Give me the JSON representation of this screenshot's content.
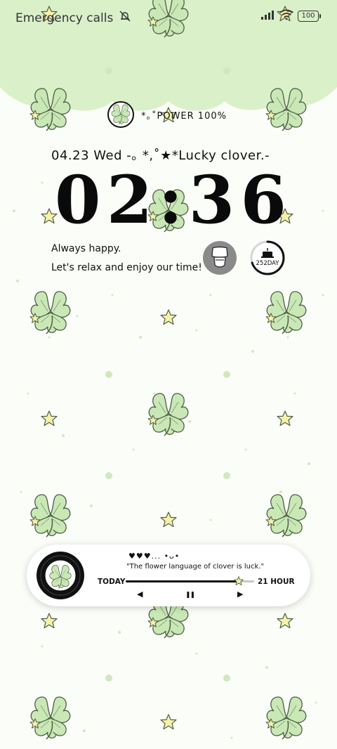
{
  "status_bar": {
    "carrier_text": "Emergency calls",
    "icons": [
      "mute-icon",
      "signal-icon",
      "wifi-icon",
      "battery-icon"
    ],
    "battery_level": "100"
  },
  "widget": {
    "power_text": "*｡˚POWER 100%",
    "date_line": "04.23 Wed -｡ *,˚★*Lucky clover.-",
    "time_digits": [
      "0",
      "2",
      ":",
      "3",
      "6"
    ],
    "message_1": "Always happy.",
    "message_2": "Let's relax and enjoy our time!",
    "day_counter": "252DAY",
    "day_ring_progress": 0.7
  },
  "music_player": {
    "hearts_text": "♥♥♥... •ᴗ•",
    "quote": "\"The flower language of clover is luck.\"",
    "progress_start_label": "TODAY",
    "progress_end_label": "21 HOUR",
    "progress": 0.88,
    "controls": {
      "prev": "◀",
      "pause": "❚❚",
      "next": "▶"
    }
  },
  "colors": {
    "header_green": "#d9f0c9",
    "leaf_green": "#c9e8b6",
    "leaf_stroke": "#5b6e52",
    "star_fill": "#f7f1a8",
    "dot_green": "#cfe9bf"
  }
}
